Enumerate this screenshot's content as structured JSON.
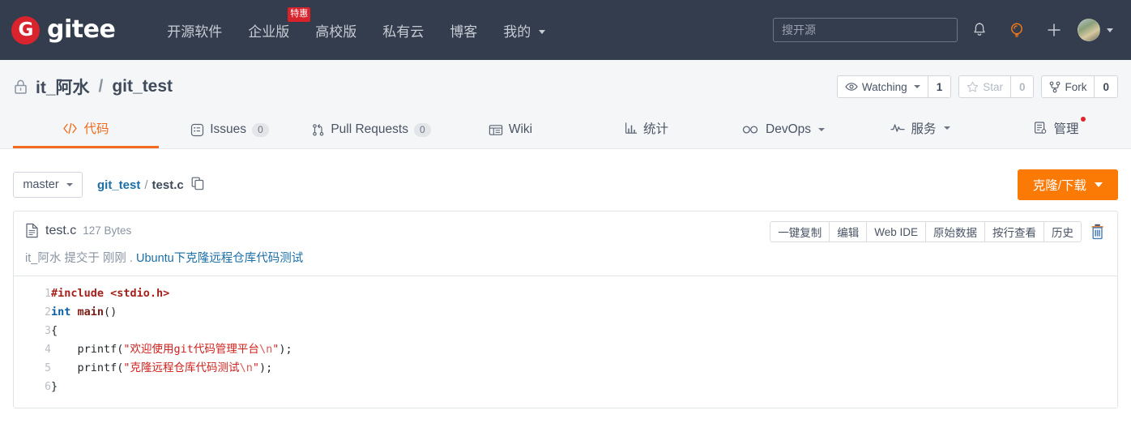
{
  "brand": {
    "name": "gitee",
    "logo_letter": "G",
    "logo_color": "#d9232d"
  },
  "topnav": {
    "items": [
      {
        "label": "开源软件",
        "has_caret": false,
        "badge": null
      },
      {
        "label": "企业版",
        "has_caret": false,
        "badge": "特惠"
      },
      {
        "label": "高校版",
        "has_caret": false,
        "badge": null
      },
      {
        "label": "私有云",
        "has_caret": false,
        "badge": null
      },
      {
        "label": "博客",
        "has_caret": false,
        "badge": null
      },
      {
        "label": "我的",
        "has_caret": true,
        "badge": null
      }
    ]
  },
  "search": {
    "placeholder": "搜开源",
    "value": ""
  },
  "topicons": [
    {
      "name": "notification-bell-icon"
    },
    {
      "name": "lightbulb-icon"
    },
    {
      "name": "plus-icon"
    },
    {
      "name": "avatar"
    }
  ],
  "repo": {
    "visibility_icon": "lock-icon",
    "owner": "it_阿水",
    "separator": "/",
    "name": "git_test",
    "watch": {
      "label": "Watching",
      "count": "1",
      "icon": "eye-icon"
    },
    "star": {
      "label": "Star",
      "count": "0",
      "icon": "star-icon"
    },
    "fork": {
      "label": "Fork",
      "count": "0",
      "icon": "fork-icon"
    }
  },
  "tabs": [
    {
      "label": "代码",
      "icon": "code-icon",
      "count": null,
      "active": true,
      "caret": false,
      "dot": false
    },
    {
      "label": "Issues",
      "icon": "issue-icon",
      "count": "0",
      "active": false,
      "caret": false,
      "dot": false
    },
    {
      "label": "Pull Requests",
      "icon": "pull-request-icon",
      "count": "0",
      "active": false,
      "caret": false,
      "dot": false
    },
    {
      "label": "Wiki",
      "icon": "wiki-icon",
      "count": null,
      "active": false,
      "caret": false,
      "dot": false
    },
    {
      "label": "统计",
      "icon": "chart-icon",
      "count": null,
      "active": false,
      "caret": false,
      "dot": false
    },
    {
      "label": "DevOps",
      "icon": "infinity-icon",
      "count": null,
      "active": false,
      "caret": true,
      "dot": false
    },
    {
      "label": "服务",
      "icon": "pulse-icon",
      "count": null,
      "active": false,
      "caret": true,
      "dot": false
    },
    {
      "label": "管理",
      "icon": "settings-list-icon",
      "count": null,
      "active": false,
      "caret": false,
      "dot": true
    }
  ],
  "toolbar": {
    "branch": "master",
    "breadcrumb": {
      "repo": "git_test",
      "slash": "/",
      "file": "test.c",
      "copy_icon": "copy-icon"
    },
    "clone_label": "克隆/下载"
  },
  "file": {
    "icon": "file-text-icon",
    "name": "test.c",
    "size": "127 Bytes",
    "commit_author": "it_阿水",
    "commit_verb": "提交于",
    "commit_time": "刚刚",
    "commit_dot": ".",
    "commit_message": "Ubuntu下克隆远程仓库代码测试",
    "actions": [
      "一键复制",
      "编辑",
      "Web IDE",
      "原始数据",
      "按行查看",
      "历史"
    ],
    "delete_icon": "trash-icon"
  },
  "code": {
    "lines": [
      {
        "no": "1",
        "tokens": [
          {
            "t": "#include ",
            "c": "pp"
          },
          {
            "t": "<stdio.h>",
            "c": "pp"
          }
        ]
      },
      {
        "no": "2",
        "tokens": [
          {
            "t": "int",
            "c": "k"
          },
          {
            "t": " ",
            "c": "pn"
          },
          {
            "t": "main",
            "c": "fn"
          },
          {
            "t": "()",
            "c": "pn"
          }
        ]
      },
      {
        "no": "3",
        "tokens": [
          {
            "t": "{",
            "c": "pn"
          }
        ]
      },
      {
        "no": "4",
        "tokens": [
          {
            "t": "    printf",
            "c": "pn"
          },
          {
            "t": "(",
            "c": "pn"
          },
          {
            "t": "\"欢迎使用git代码管理平台",
            "c": "st"
          },
          {
            "t": "\\n",
            "c": "es"
          },
          {
            "t": "\"",
            "c": "st"
          },
          {
            "t": ");",
            "c": "pn"
          }
        ]
      },
      {
        "no": "5",
        "tokens": [
          {
            "t": "    printf",
            "c": "pn"
          },
          {
            "t": "(",
            "c": "pn"
          },
          {
            "t": "\"克隆远程仓库代码测试",
            "c": "st"
          },
          {
            "t": "\\n",
            "c": "es"
          },
          {
            "t": "\"",
            "c": "st"
          },
          {
            "t": ");",
            "c": "pn"
          }
        ]
      },
      {
        "no": "6",
        "tokens": [
          {
            "t": "}",
            "c": "pn"
          }
        ]
      }
    ]
  },
  "colors": {
    "header_bg": "#343d4d",
    "accent_orange": "#f06b1f",
    "clone_orange": "#fb7905",
    "link_blue": "#1a6fa8",
    "badge_red": "#d7232b"
  }
}
